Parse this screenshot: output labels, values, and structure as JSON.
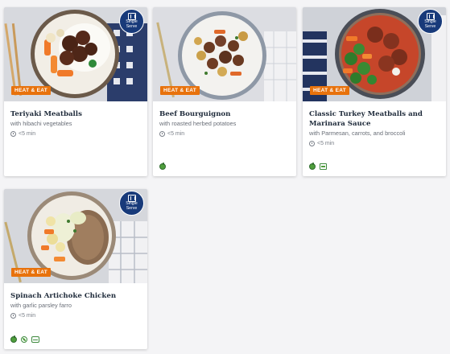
{
  "badges": {
    "single_serve": "Single Serve",
    "heat_and_eat": "HEAT & EAT"
  },
  "meals": [
    {
      "title": "Teriyaki Meatballs",
      "subtitle": "with hibachi vegetables",
      "time": "<5 min",
      "diet_icons": []
    },
    {
      "title": "Beef Bourguignon",
      "subtitle": "with roasted herbed potatoes",
      "time": "<5 min",
      "diet_icons": [
        "veggie-icon"
      ]
    },
    {
      "title": "Classic Turkey Meatballs and Marinara Sauce",
      "subtitle": "with Parmesan, carrots, and broccoli",
      "time": "<5 min",
      "diet_icons": [
        "veggie-icon",
        "calorie-smart-icon"
      ]
    },
    {
      "title": "Spinach Artichoke Chicken",
      "subtitle": "with garlic parsley farro",
      "time": "<5 min",
      "diet_icons": [
        "veggie-icon",
        "leaf-icon",
        "protein-icon"
      ]
    }
  ],
  "colors": {
    "heat_tag": "#e8720c",
    "single_serve_badge": "#183a7a",
    "title": "#1e2a3a",
    "diet_green": "#4f9e3c"
  }
}
